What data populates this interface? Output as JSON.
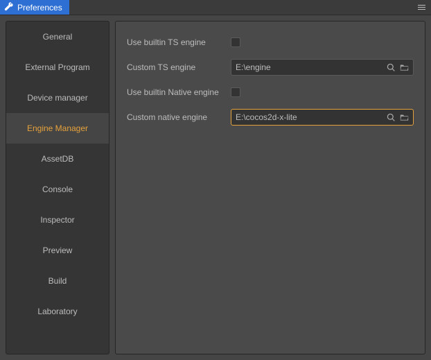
{
  "header": {
    "title": "Preferences"
  },
  "sidebar": {
    "items": [
      {
        "label": "General",
        "active": false
      },
      {
        "label": "External Program",
        "active": false
      },
      {
        "label": "Device manager",
        "active": false
      },
      {
        "label": "Engine Manager",
        "active": true
      },
      {
        "label": "AssetDB",
        "active": false
      },
      {
        "label": "Console",
        "active": false
      },
      {
        "label": "Inspector",
        "active": false
      },
      {
        "label": "Preview",
        "active": false
      },
      {
        "label": "Build",
        "active": false
      },
      {
        "label": "Laboratory",
        "active": false
      }
    ]
  },
  "main": {
    "use_builtin_ts_label": "Use builtin TS engine",
    "use_builtin_ts_checked": false,
    "custom_ts_label": "Custom TS engine",
    "custom_ts_value": "E:\\engine",
    "use_builtin_native_label": "Use builtin Native engine",
    "use_builtin_native_checked": false,
    "custom_native_label": "Custom native engine",
    "custom_native_value": "E:\\cocos2d-x-lite"
  }
}
